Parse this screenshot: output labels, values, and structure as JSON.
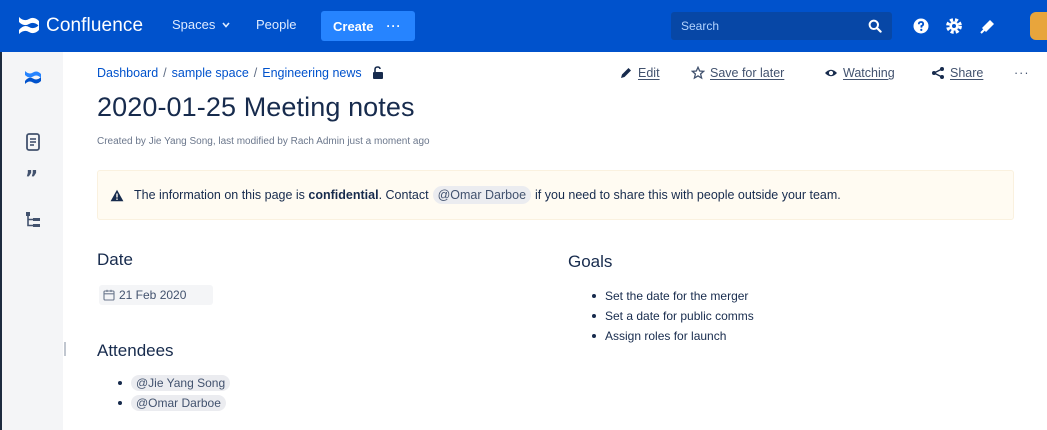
{
  "colors": {
    "nav_bg": "#0052cc",
    "create_bg": "#2684ff",
    "search_bg": "#0747a6",
    "link": "#0052cc",
    "panel_bg": "#fffbf2",
    "warning": "#172b4d",
    "mention_bg": "#ebecf0"
  },
  "topnav": {
    "logo_text": "Confluence",
    "spaces_label": "Spaces",
    "people_label": "People",
    "create_label": "Create",
    "create_more": "···",
    "search_placeholder": "Search",
    "icons": [
      "search-icon",
      "help-icon",
      "settings-icon",
      "notification-icon",
      "avatar"
    ]
  },
  "sidebar": {
    "icons": [
      "confluence-home-icon",
      "pages-icon",
      "blog-quote-icon",
      "page-tree-icon"
    ]
  },
  "breadcrumb": [
    "Dashboard",
    "sample space",
    "Engineering news"
  ],
  "breadcrumb_separator": "/",
  "actions": {
    "edit": "Edit",
    "save": "Save for later",
    "watch": "Watching",
    "share": "Share",
    "more": "···"
  },
  "page": {
    "title": "2020-01-25 Meeting notes",
    "byline": "Created by Jie Yang Song, last modified by Rach Admin just a moment ago"
  },
  "panel": {
    "prefix": "The information on this page is",
    "bold": "confidential",
    "mid": ". Contact",
    "mention": "@Omar Darboe",
    "suffix": "if you need to share this with people outside your team."
  },
  "date_section": {
    "heading": "Date",
    "value": "21 Feb 2020"
  },
  "goals_section": {
    "heading": "Goals",
    "items": [
      "Set the date for the merger",
      "Set a date for public comms",
      "Assign roles for launch"
    ]
  },
  "attendees_section": {
    "heading": "Attendees",
    "people": [
      "@Jie Yang Song",
      "@Omar Darboe"
    ]
  }
}
